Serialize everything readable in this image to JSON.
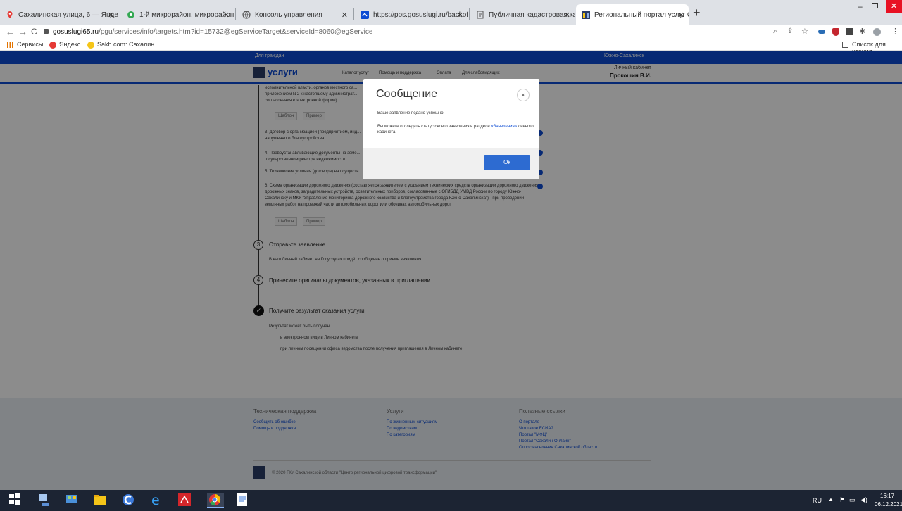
{
  "browser": {
    "tabs": [
      {
        "label": "Сахалинская улица, 6 — Яндекс",
        "active": false
      },
      {
        "label": "1-й микрорайон, микрорайон,",
        "active": false
      },
      {
        "label": "Консоль управления",
        "active": false
      },
      {
        "label": "https://pos.gosuslugi.ru/backoffic",
        "active": false
      },
      {
        "label": "Публичная кадастровая карта -",
        "active": false
      },
      {
        "label": "Региональный портал услуг Сах",
        "active": true
      }
    ],
    "url_host": "gosuslugi65.ru",
    "url_path": "/pgu/services/info/targets.htm?id=15732@egServiceTarget&serviceId=8060@egService",
    "bookmarks": [
      "Сервисы",
      "Яндекс",
      "Sakh.com: Сахалин..."
    ],
    "reading_list": "Список для чтения"
  },
  "site": {
    "top_left": "Для граждан",
    "top_right": "Южно-Сахалинск",
    "logo_text": "услуги",
    "nav": [
      "Каталог услуг",
      "Помощь и поддержка",
      "Оплата",
      "Для слабовидящих"
    ],
    "cabinet_label": "Личный кабинет",
    "user_name": "Прокошин В.И."
  },
  "content": {
    "item_top": "исполнительной власти, органов местного са... приложением N 2 к настоящему администрат... согласования в электронной форме)",
    "items": [
      "3. Договор с организацией (предприятием, инд... нарушенного благоустройства",
      "4. Правоустанавливающие документы на земе... государственном реестре недвижимости",
      "5. Технические условия (договора) на осуществ...",
      "6. Схема организации дорожного движения (составляется заявителем с указанием технических средств организации дорожного движения: дорожных знаков, заградительных устройств, осветительных приборов, согласованные с ОГИБДД УМВД России по городу Южно-Сахалинску и МКУ \"Управление мониторинга дорожного хозяйства и благоустройства города Южно-Сахалинска\") - при проведении земляных работ на проезжей части автомобильных дорог или обочинах автомобильных дорог"
    ],
    "btn_template": "Шаблон",
    "btn_example": "Пример",
    "steps": [
      {
        "num": "3",
        "title": "Отправьте заявление",
        "text": "В ваш Личный кабинет на Госуслугах придёт сообщение о приеме заявления."
      },
      {
        "num": "4",
        "title": "Принесите оригиналы документов, указанных в приглашении",
        "text": ""
      },
      {
        "num": "",
        "title": "Получите результат оказания услуги",
        "text": "Результат может быть получен:"
      }
    ],
    "result_bullets": [
      "в электронном виде в Личном кабинете",
      "при личном посещении офиса ведомства после получения приглашения в Личном кабинете"
    ]
  },
  "footer": {
    "col1_title": "Техническая поддержка",
    "col1_links": [
      "Сообщить об ошибке",
      "Помощь и поддержка"
    ],
    "col2_title": "Услуги",
    "col2_links": [
      "По жизненным ситуациям",
      "По ведомствам",
      "По категориям"
    ],
    "col3_title": "Полезные ссылки",
    "col3_links": [
      "О портале",
      "Что такое ЕСИА?",
      "Портал \"МФЦ\"",
      "Портал \"Сахалин Онлайн\"",
      "Опрос населения Сахалинской области"
    ],
    "copyright": "© 2020 ГКУ Сахалинской области \"Центр региональной цифровой трансформации\""
  },
  "modal": {
    "title": "Сообщение",
    "line1": "Ваше заявление подано успешно.",
    "line2_pre": "Вы можете отследить статус своего заявления в разделе ",
    "line2_link": "«Заявления»",
    "line2_post": " личного кабинета.",
    "ok_label": "Ок",
    "close_symbol": "×"
  },
  "taskbar": {
    "lang": "RU",
    "time": "16:17",
    "date": "06.12.2021"
  },
  "colors": {
    "brand_blue": "#0d4cd3",
    "ok_button": "#2d6bd1",
    "taskbar": "#1c2433"
  }
}
